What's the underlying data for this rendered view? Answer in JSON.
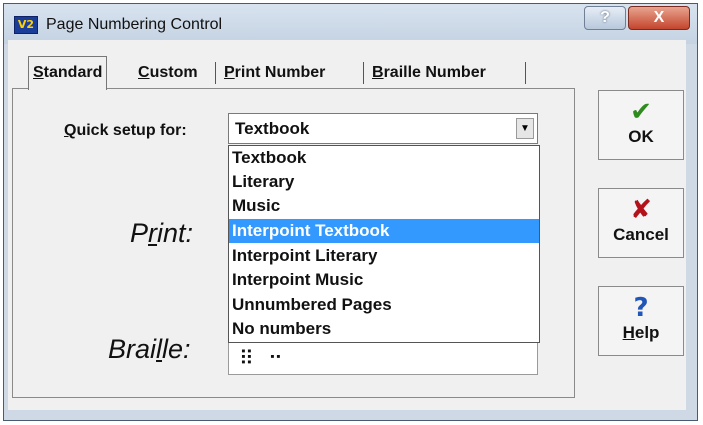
{
  "window": {
    "title": "Page Numbering Control",
    "app_icon_text": "V2"
  },
  "titlebar": {
    "help_glyph": "?",
    "close_glyph": "X"
  },
  "tabs": [
    {
      "label": "Standard",
      "accel": "S",
      "rest": "tandard"
    },
    {
      "label": "Custom",
      "accel": "C",
      "rest": "ustom"
    },
    {
      "label": "Print Number",
      "accel": "P",
      "rest": "rint Number"
    },
    {
      "label": "Braille Number",
      "accel": "B",
      "rest": "raille Number"
    }
  ],
  "quick_setup": {
    "label_accel": "Q",
    "label_rest": "uick setup for:",
    "selected": "Textbook",
    "options": [
      "Textbook",
      "Literary",
      "Music",
      "Interpoint Textbook",
      "Interpoint Literary",
      "Interpoint Music",
      "Unnumbered Pages",
      "No numbers"
    ],
    "highlighted_index": 3
  },
  "print_label": {
    "pre": "P",
    "accel": "r",
    "post": "int:"
  },
  "braille_label": {
    "pre": "Brai",
    "accel": "l",
    "post": "le:"
  },
  "braille_field": {
    "cells": "⠿ ⠒"
  },
  "buttons": {
    "ok": {
      "label": "OK",
      "icon": "checkmark-icon",
      "glyph": "✔",
      "color": "#2e8b1e"
    },
    "cancel": {
      "label": "Cancel",
      "icon": "x-mark-icon",
      "glyph": "✘",
      "color": "#b3121a"
    },
    "help": {
      "accel": "H",
      "rest": "elp",
      "icon": "question-icon",
      "glyph": "?",
      "color": "#1f56b8"
    }
  }
}
